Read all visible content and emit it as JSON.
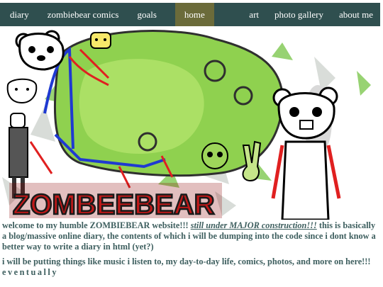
{
  "nav": {
    "items": [
      {
        "label": "diary"
      },
      {
        "label": "zombiebear comics"
      },
      {
        "label": "goals"
      },
      {
        "label": "home",
        "active": true
      },
      {
        "label": "art"
      },
      {
        "label": "photo gallery"
      },
      {
        "label": "about me"
      }
    ],
    "bg_color": "#2f4f4f",
    "active_color": "#6b6b3a"
  },
  "banner": {
    "logo_text": "ZOMBEEBEAR"
  },
  "content": {
    "p1_start": "welcome to my humble ZOMBIEBEAR website!!!",
    "p1_link": "still under MAJOR construction!!!",
    "p1_rest": "this is basically a blog/massive online diary, the contents of which i will be dumping into the code since i dont know a better way to write a diary in html (yet?)",
    "p2_start": "i will be putting things like music i listen to, my day-to-day life, comics, photos, and more on here!!!",
    "p2_spaced": "eventually",
    "text_color": "#3e5f5f"
  }
}
